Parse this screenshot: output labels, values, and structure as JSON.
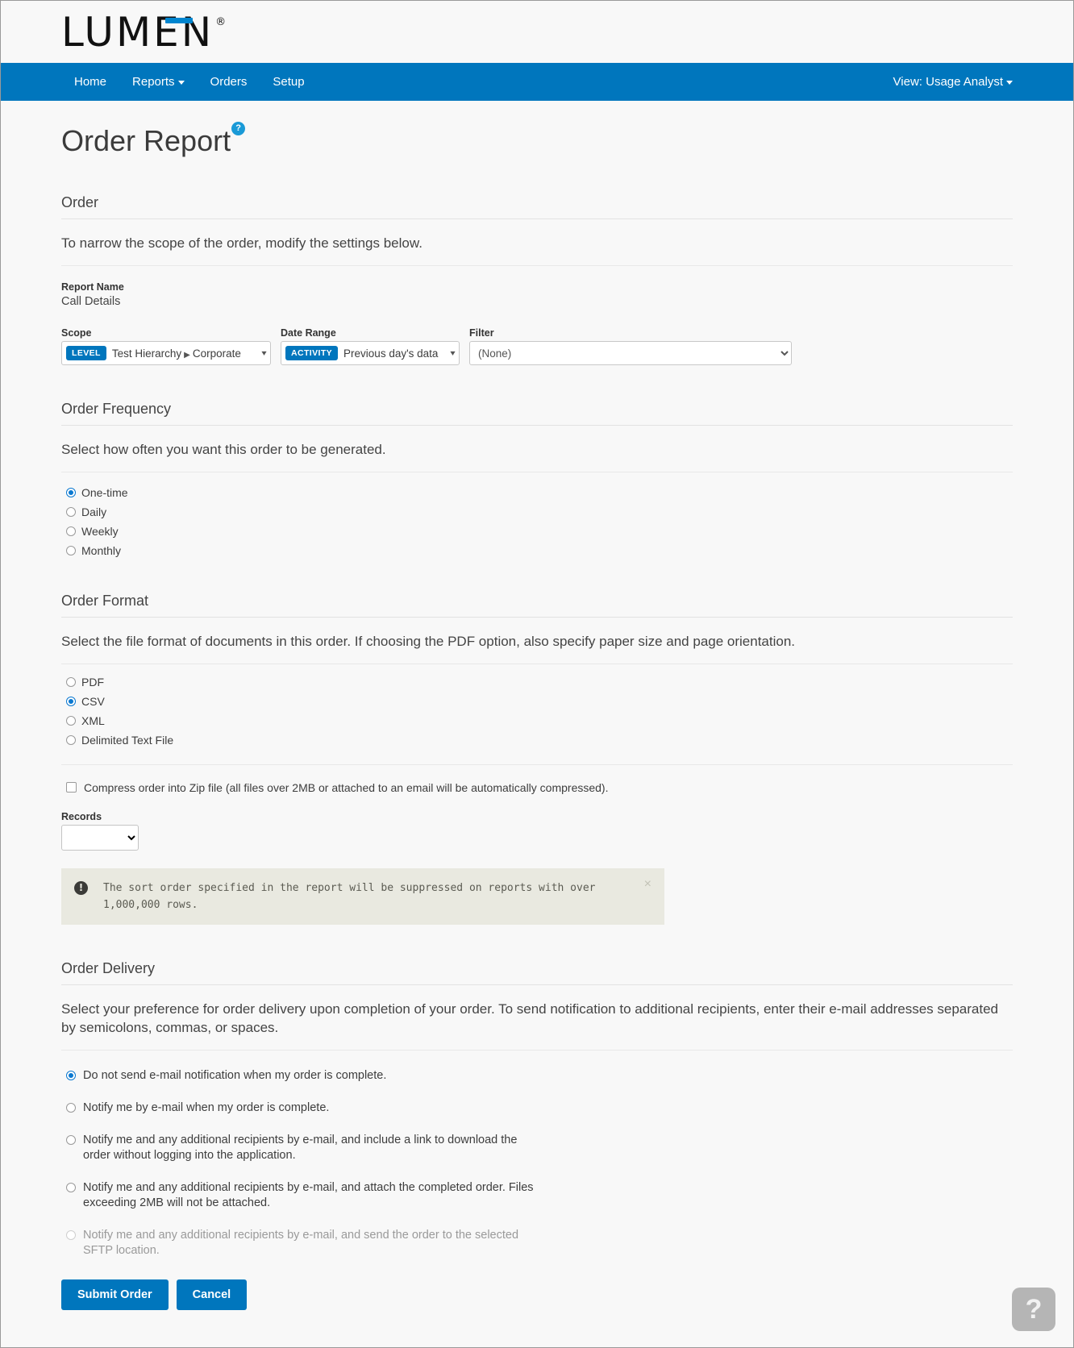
{
  "brand": {
    "logo_text": "LUMEN",
    "registered_mark": "®"
  },
  "nav": {
    "items": [
      {
        "label": "Home",
        "has_caret": false
      },
      {
        "label": "Reports",
        "has_caret": true
      },
      {
        "label": "Orders",
        "has_caret": false
      },
      {
        "label": "Setup",
        "has_caret": false
      }
    ],
    "view_label": "View: Usage Analyst"
  },
  "page": {
    "title": "Order Report",
    "help_badge": "?"
  },
  "order_section": {
    "heading": "Order",
    "description": "To narrow the scope of the order, modify the settings below.",
    "report_name_label": "Report Name",
    "report_name_value": "Call Details",
    "scope": {
      "label": "Scope",
      "tag": "LEVEL",
      "value_root": "Test Hierarchy",
      "value_separator": "▶",
      "value_leaf": "Corporate"
    },
    "date_range": {
      "label": "Date Range",
      "tag": "ACTIVITY",
      "value": "Previous day's data"
    },
    "filter": {
      "label": "Filter",
      "value": "(None)"
    }
  },
  "frequency_section": {
    "heading": "Order Frequency",
    "description": "Select how often you want this order to be generated.",
    "options": [
      {
        "label": "One-time",
        "selected": true
      },
      {
        "label": "Daily",
        "selected": false
      },
      {
        "label": "Weekly",
        "selected": false
      },
      {
        "label": "Monthly",
        "selected": false
      }
    ]
  },
  "format_section": {
    "heading": "Order Format",
    "description": "Select the file format of documents in this order. If choosing the PDF option, also specify paper size and page orientation.",
    "options": [
      {
        "label": "PDF",
        "selected": false
      },
      {
        "label": "CSV",
        "selected": true
      },
      {
        "label": "XML",
        "selected": false
      },
      {
        "label": "Delimited Text File",
        "selected": false
      }
    ],
    "compress": {
      "label": "Compress order into Zip file (all files over 2MB or attached to an email will be automatically compressed).",
      "checked": false
    },
    "records": {
      "label": "Records",
      "value": ""
    },
    "alert": {
      "icon": "!",
      "message": "The sort order specified in the report will be suppressed on reports with over 1,000,000 rows.",
      "close": "×"
    }
  },
  "delivery_section": {
    "heading": "Order Delivery",
    "description": "Select your preference for order delivery upon completion of your order. To send notification to additional recipients, enter their e-mail addresses separated by semicolons, commas, or spaces.",
    "options": [
      {
        "label": "Do not send e-mail notification when my order is complete.",
        "selected": true,
        "disabled": false
      },
      {
        "label": "Notify me by e-mail when my order is complete.",
        "selected": false,
        "disabled": false
      },
      {
        "label": "Notify me and any additional recipients by e-mail, and include a link to download the order without logging into the application.",
        "selected": false,
        "disabled": false
      },
      {
        "label": "Notify me and any additional recipients by e-mail, and attach the completed order. Files exceeding 2MB will not be attached.",
        "selected": false,
        "disabled": false
      },
      {
        "label": "Notify me and any additional recipients by e-mail, and send the order to the selected SFTP location.",
        "selected": false,
        "disabled": true
      }
    ]
  },
  "actions": {
    "submit_label": "Submit Order",
    "cancel_label": "Cancel"
  },
  "floating_help": {
    "label": "?"
  },
  "colors": {
    "brand_blue": "#0076bd",
    "logo_accent": "#0085cf",
    "help_badge": "#1a9ad7",
    "alert_bg": "#e9e9e0",
    "page_bg": "#f8f8f8"
  }
}
